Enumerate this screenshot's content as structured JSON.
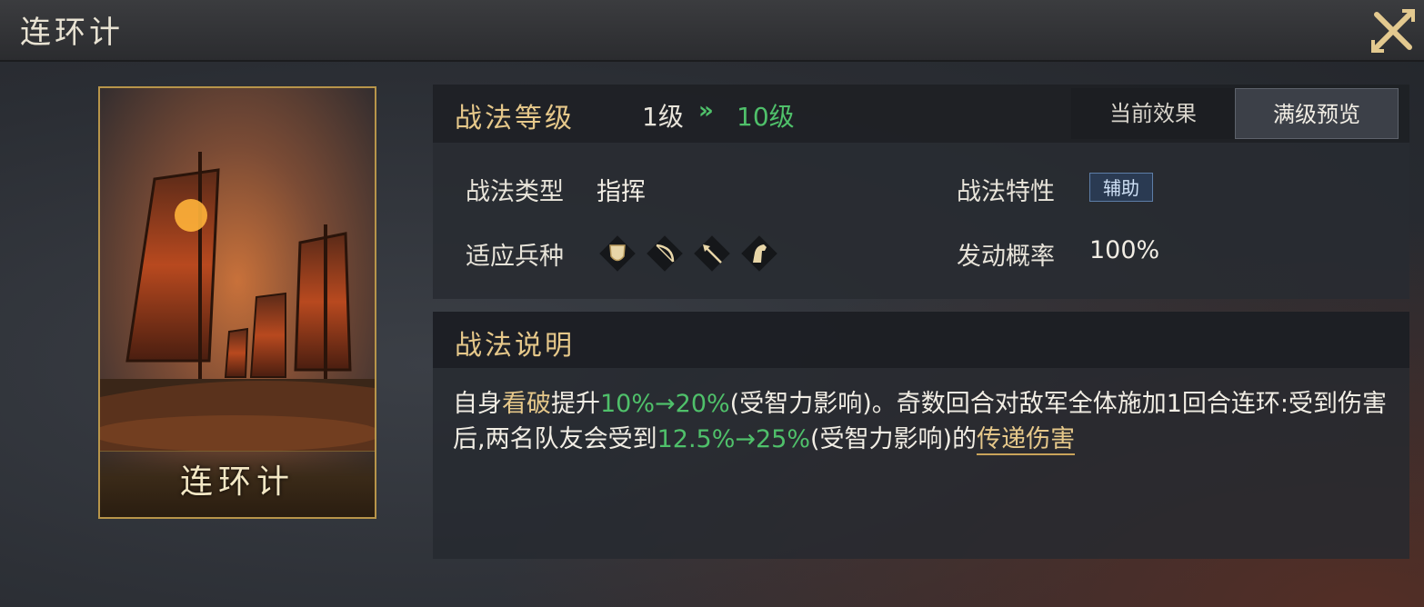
{
  "window": {
    "title": "连环计"
  },
  "card": {
    "name": "连环计"
  },
  "level": {
    "label": "战法等级",
    "from": "1级",
    "arrow": "»",
    "to": "10级"
  },
  "tabs": {
    "current": "当前效果",
    "max": "满级预览",
    "selected": "满级预览"
  },
  "attributes": {
    "type_label": "战法类型",
    "type_value": "指挥",
    "trait_label": "战法特性",
    "trait_value": "辅助",
    "units_label": "适应兵种",
    "units": [
      "shield-icon",
      "bow-icon",
      "spear-icon",
      "horse-icon"
    ],
    "rate_label": "发动概率",
    "rate_value": "100%"
  },
  "description": {
    "title": "战法说明",
    "t1": "自身",
    "t2": "看破",
    "t3": "提升",
    "t4": "10%→20%",
    "t5": "(受智力影响)。奇数回合对敌军全体施加1回合连环:受到伤害后,两名队友会受到",
    "t6": "12.5%→25%",
    "t7": "(受智力影响)的",
    "t8": "传递伤害"
  },
  "colors": {
    "accent_gold": "#e6c88a",
    "upgrade_green": "#4fc06a"
  }
}
